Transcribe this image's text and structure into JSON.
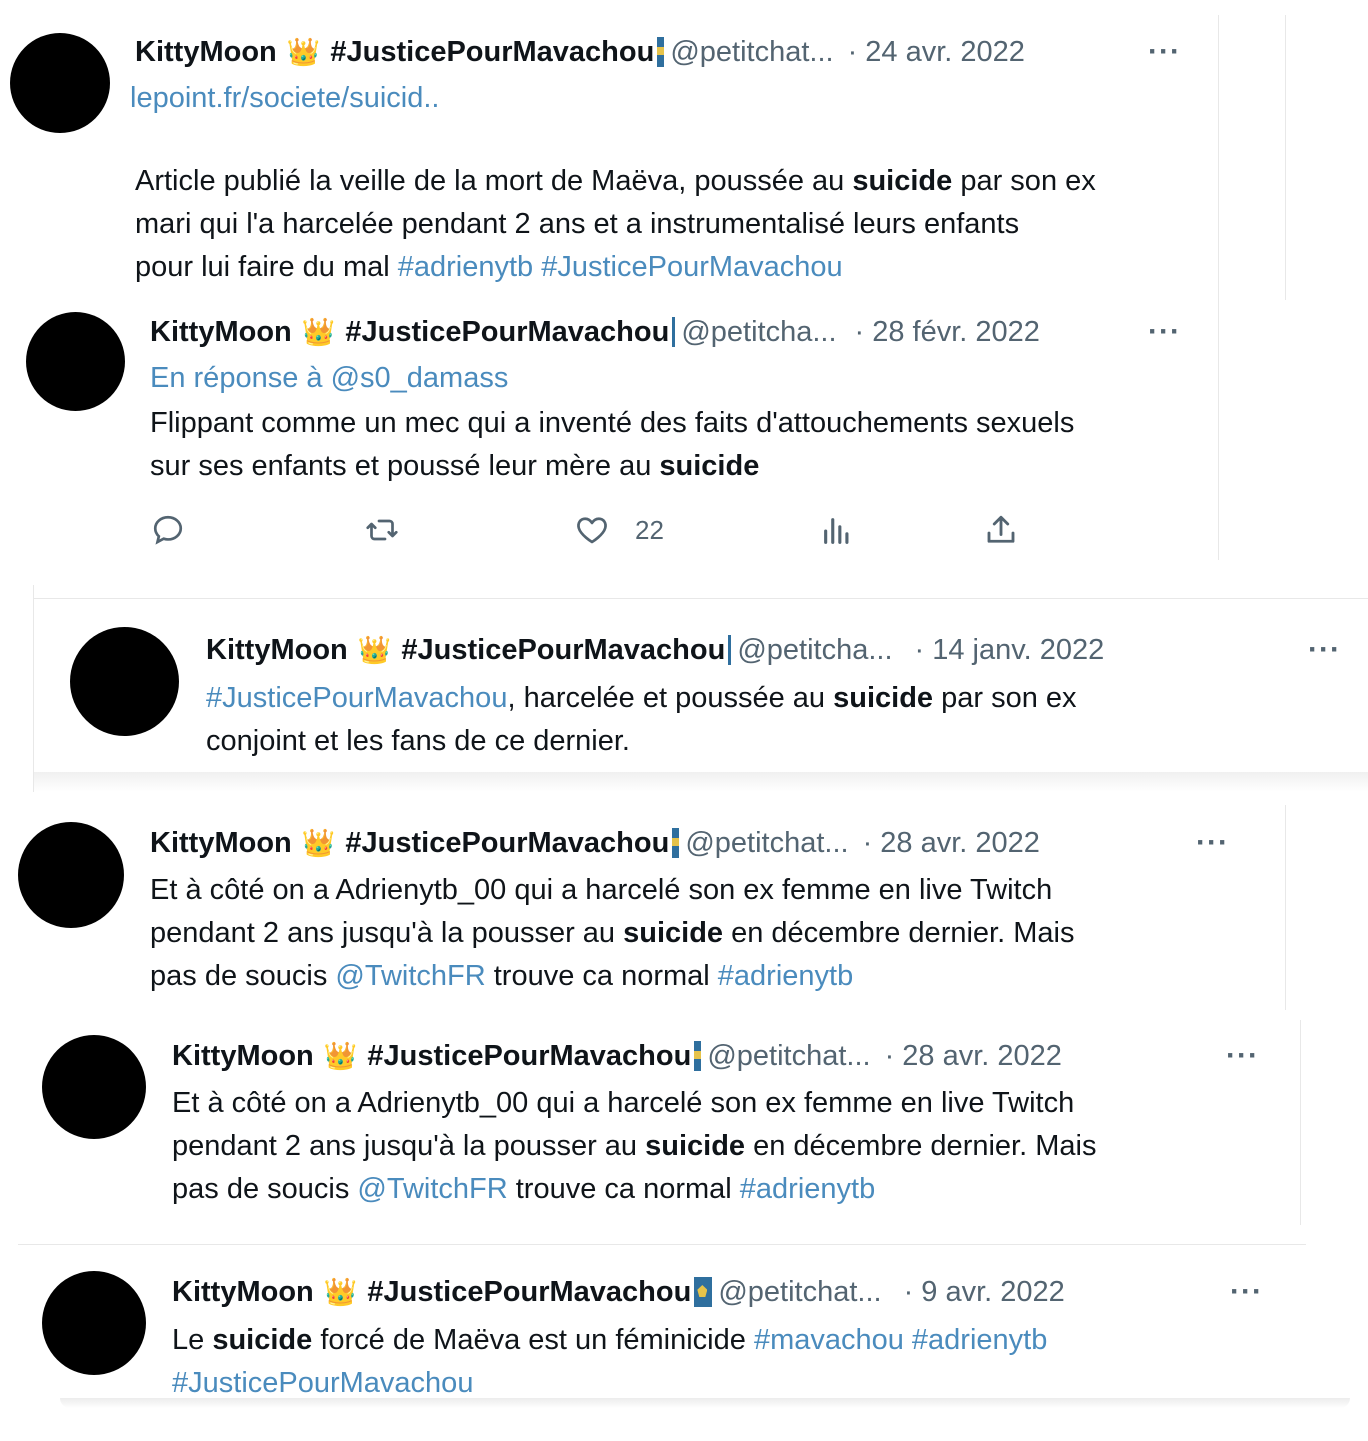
{
  "tweets": [
    {
      "name": "KittyMoon",
      "crown": "👑",
      "tag": "#JusticePourMavachou",
      "handle": "@petitchat...",
      "date": "· 24 avr. 2022",
      "more": "···",
      "link": "lepoint.fr/societe/suicid..",
      "body": [
        "Article publié la veille de la mort de Maëva, poussée au ",
        "suicide",
        " par son ex",
        "mari qui l'a harcelée pendant 2 ans et a instrumentalisé leurs enfants",
        "pour lui faire du mal ",
        "#adrienytb #JusticePourMavachou"
      ]
    },
    {
      "name": "KittyMoon",
      "crown": "👑",
      "tag": "#JusticePourMavachou",
      "handle": "@petitcha...",
      "date": "· 28 févr. 2022",
      "more": "···",
      "reply_prefix": "En réponse à ",
      "reply_to": "@s0_damass",
      "body": [
        "Flippant comme un mec qui a inventé des faits d'attouchements sexuels",
        "sur ses enfants et poussé leur mère au ",
        "suicide"
      ],
      "actions": {
        "reply": "reply-icon",
        "retweet": "retweet-icon",
        "like": "heart-icon",
        "like_count": "22",
        "views": "views-icon",
        "share": "share-icon"
      }
    },
    {
      "name": "KittyMoon",
      "crown": "👑",
      "tag": "#JusticePourMavachou",
      "handle": "@petitcha...",
      "date": "· 14 janv. 2022",
      "more": "···",
      "body": [
        "#JusticePourMavachou",
        ", harcelée et poussée au ",
        "suicide",
        " par son ex",
        "conjoint et les fans de ce dernier."
      ]
    },
    {
      "name": "KittyMoon",
      "crown": "👑",
      "tag": "#JusticePourMavachou",
      "handle": "@petitchat...",
      "date": "· 28 avr. 2022",
      "more": "···",
      "body": [
        "Et à côté on a Adrienytb_00 qui a harcelé son ex femme en live Twitch",
        "pendant 2 ans jusqu'à la pousser au ",
        "suicide",
        " en décembre dernier. Mais",
        "pas de soucis ",
        "@TwitchFR",
        " trouve ca normal ",
        "#adrienytb"
      ]
    },
    {
      "name": "KittyMoon",
      "crown": "👑",
      "tag": "#JusticePourMavachou",
      "handle": "@petitchat...",
      "date": "· 28 avr. 2022",
      "more": "···",
      "body": [
        "Et à côté on a Adrienytb_00 qui a harcelé son ex femme en live Twitch",
        "pendant 2 ans jusqu'à la pousser au ",
        "suicide",
        " en décembre dernier. Mais",
        "pas de soucis ",
        "@TwitchFR",
        " trouve ca normal ",
        "#adrienytb"
      ]
    },
    {
      "name": "KittyMoon",
      "crown": "👑",
      "tag": "#JusticePourMavachou",
      "handle": "@petitchat...",
      "date": "· 9 avr. 2022",
      "more": "···",
      "body": [
        "Le ",
        "suicide",
        " forcé de Maëva est un féminicide ",
        "#mavachou #adrienytb",
        "#JusticePourMavachou"
      ]
    }
  ]
}
